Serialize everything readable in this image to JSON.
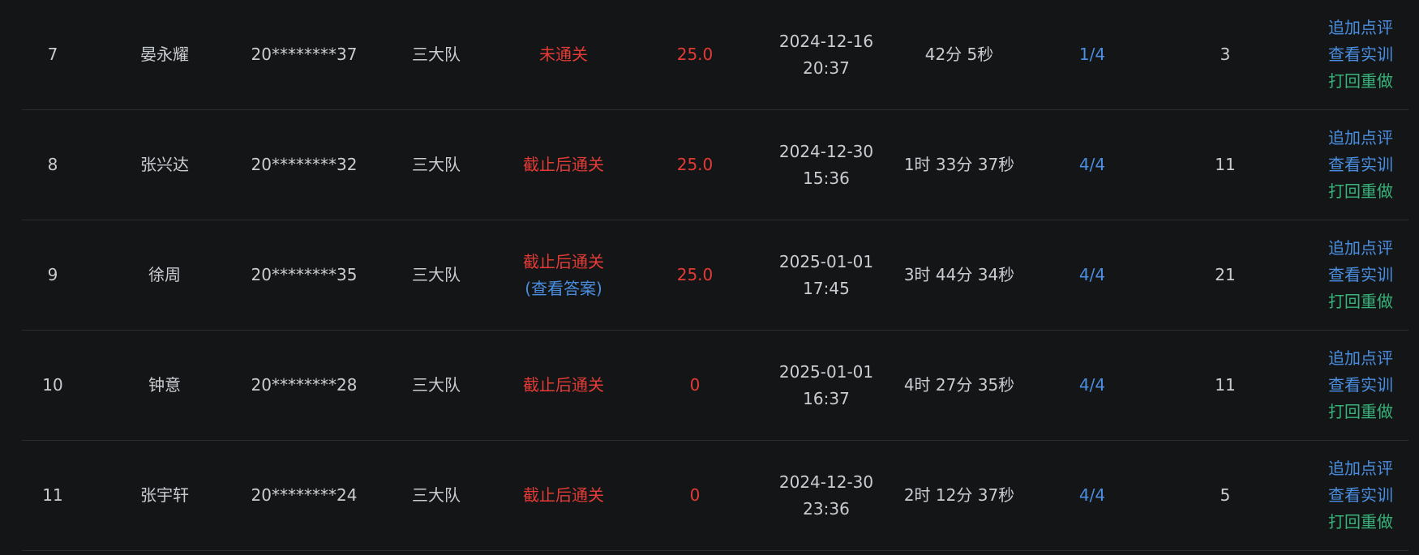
{
  "actions": {
    "comment": "追加点评",
    "view": "查看实训",
    "redo": "打回重做"
  },
  "colors": {
    "background": "#141517",
    "text": "#c9cdd1",
    "red": "#e23b35",
    "blue": "#4a8fe0",
    "green": "#38b27a",
    "divider": "#2a2d31"
  },
  "rows": [
    {
      "no": "7",
      "name": "晏永耀",
      "id": "20********37",
      "team": "三大队",
      "status": "未通关",
      "status_extra": "",
      "score": "25.0",
      "date": "2024-12-16",
      "time": "20:37",
      "duration": "42分 5秒",
      "progress": "1/4",
      "count": "3"
    },
    {
      "no": "8",
      "name": "张兴达",
      "id": "20********32",
      "team": "三大队",
      "status": "截止后通关",
      "status_extra": "",
      "score": "25.0",
      "date": "2024-12-30",
      "time": "15:36",
      "duration": "1时 33分 37秒",
      "progress": "4/4",
      "count": "11"
    },
    {
      "no": "9",
      "name": "徐周",
      "id": "20********35",
      "team": "三大队",
      "status": "截止后通关",
      "status_extra": "(查看答案)",
      "score": "25.0",
      "date": "2025-01-01",
      "time": "17:45",
      "duration": "3时 44分 34秒",
      "progress": "4/4",
      "count": "21"
    },
    {
      "no": "10",
      "name": "钟意",
      "id": "20********28",
      "team": "三大队",
      "status": "截止后通关",
      "status_extra": "",
      "score": "0",
      "date": "2025-01-01",
      "time": "16:37",
      "duration": "4时 27分 35秒",
      "progress": "4/4",
      "count": "11"
    },
    {
      "no": "11",
      "name": "张宇轩",
      "id": "20********24",
      "team": "三大队",
      "status": "截止后通关",
      "status_extra": "",
      "score": "0",
      "date": "2024-12-30",
      "time": "23:36",
      "duration": "2时 12分 37秒",
      "progress": "4/4",
      "count": "5"
    }
  ]
}
